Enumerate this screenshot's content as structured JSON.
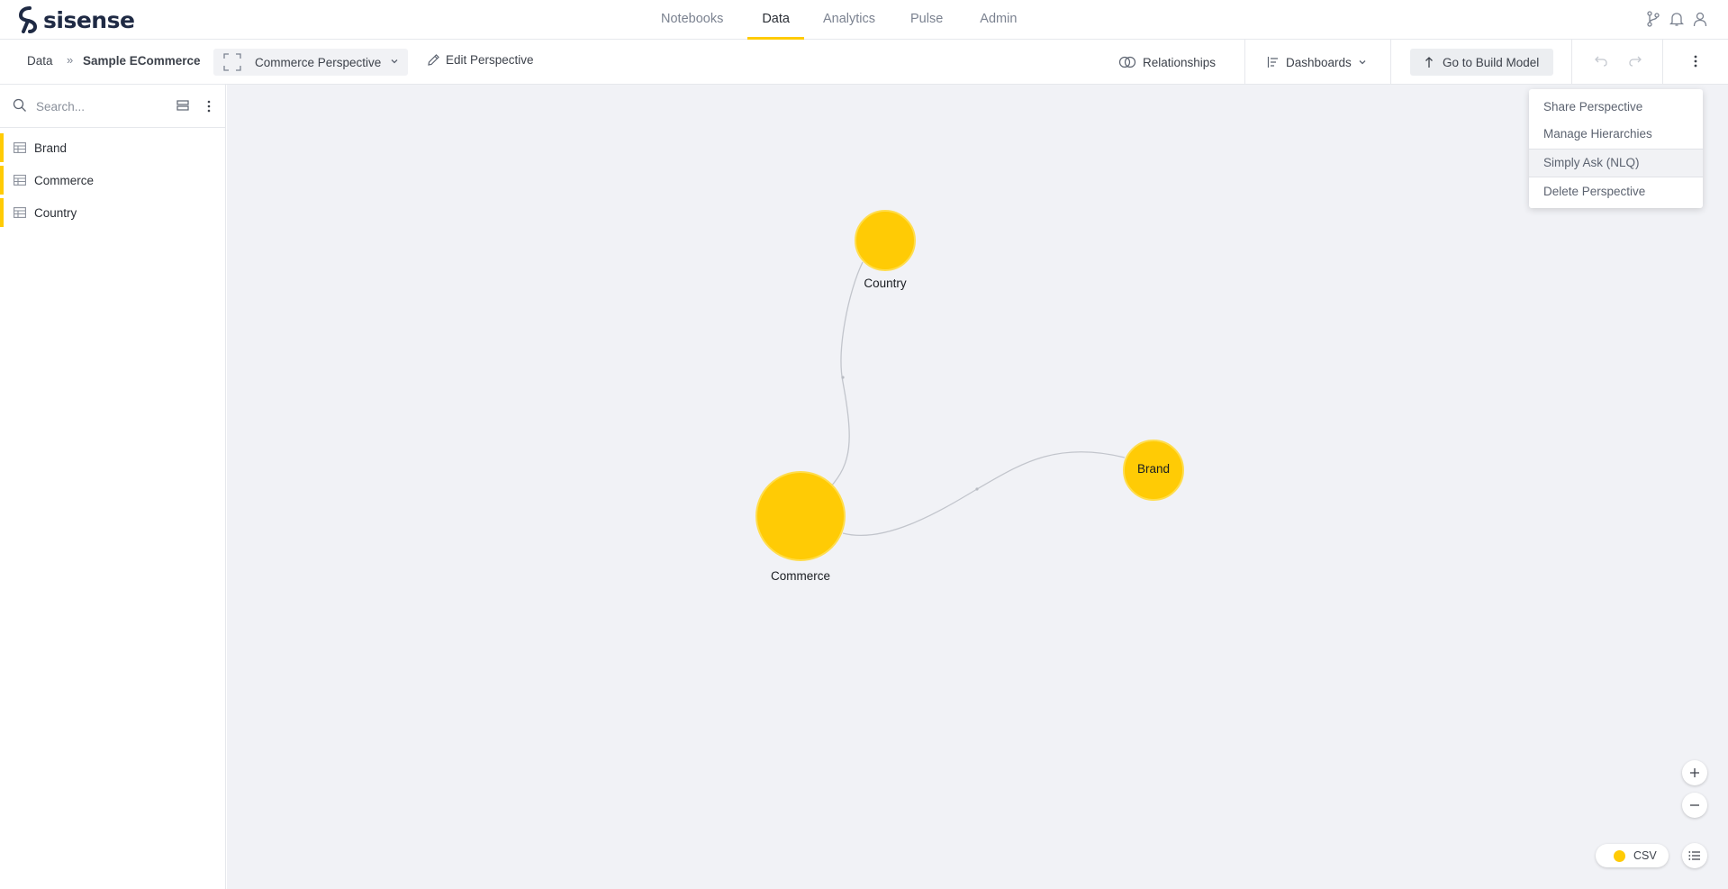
{
  "app": {
    "logo_text": "sisense"
  },
  "nav": {
    "tabs": [
      {
        "label": "Notebooks",
        "active": false
      },
      {
        "label": "Data",
        "active": true
      },
      {
        "label": "Analytics",
        "active": false
      },
      {
        "label": "Pulse",
        "active": false
      },
      {
        "label": "Admin",
        "active": false
      }
    ],
    "icons": [
      "git-branch-icon",
      "bell-icon",
      "user-icon"
    ]
  },
  "toolbar": {
    "breadcrumb_root": "Data",
    "breadcrumb_model": "Sample ECommerce",
    "perspective_label": "Commerce Perspective",
    "edit_perspective": "Edit Perspective",
    "relationships": "Relationships",
    "dashboards": "Dashboards",
    "build_model": "Go to Build Model"
  },
  "sidebar": {
    "search_placeholder": "Search...",
    "tables": [
      {
        "name": "Brand"
      },
      {
        "name": "Commerce"
      },
      {
        "name": "Country"
      }
    ]
  },
  "graph": {
    "nodes": [
      {
        "name": "Country",
        "label_inside": false
      },
      {
        "name": "Commerce",
        "label_inside": false
      },
      {
        "name": "Brand",
        "label_inside": true
      }
    ],
    "edges": [
      {
        "from": "Country",
        "to": "Commerce"
      },
      {
        "from": "Commerce",
        "to": "Brand"
      }
    ],
    "node_color": "#ffcb05"
  },
  "menu": {
    "items": [
      {
        "label": "Share Perspective",
        "highlighted": false
      },
      {
        "label": "Manage Hierarchies",
        "highlighted": false
      },
      {
        "label": "Simply Ask (NLQ)",
        "highlighted": true
      },
      {
        "label": "Delete Perspective",
        "highlighted": false
      }
    ]
  },
  "legend": {
    "label": "CSV",
    "color": "#ffcb05"
  },
  "colors": {
    "accent": "#ffcb05",
    "canvas_bg": "#f1f2f6"
  }
}
